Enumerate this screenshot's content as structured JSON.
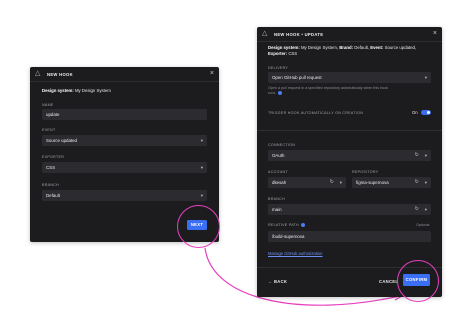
{
  "left_modal": {
    "title": "NEW HOOK",
    "summary_label": "Design system:",
    "summary_value": "My Design System",
    "name_label": "NAME",
    "name_value": "update",
    "event_label": "EVENT",
    "event_value": "Source updated",
    "exporter_label": "EXPORTER",
    "exporter_value": "CSS",
    "branch_label": "BRANCH",
    "branch_value": "Default",
    "next_label": "NEXT"
  },
  "right_modal": {
    "title": "NEW HOOK • UPDATE",
    "summary": {
      "ds_label": "Design system:",
      "ds_value": "My Design System,",
      "branch_label": "Brand:",
      "branch_value": "Default,",
      "event_label": "Event:",
      "event_value": "Source updated,",
      "exporter_label": "Exporter:",
      "exporter_value": "CSS"
    },
    "delivery_label": "DELIVERY",
    "delivery_value": "Open GitHub pull request",
    "delivery_hint": "Open a pull request in a specified repository automatically when this hook runs.",
    "trigger_label": "TRIGGER HOOK AUTOMATICALLY ON CREATION",
    "trigger_state": "On",
    "connection_label": "CONNECTION",
    "connection_value": "OAuth",
    "account_label": "ACCOUNT",
    "account_value": "dkesah",
    "repository_label": "REPOSITORY",
    "repository_value": "figma-supernova",
    "branch_label": "BRANCH",
    "branch_value": "main",
    "path_label": "RELATIVE PATH",
    "path_optional": "Optional",
    "path_value": "/build-supernova",
    "manage_link": "Manage GitHub authorization",
    "back_label": "BACK",
    "cancel_label": "CANCEL",
    "confirm_label": "CONFIRM"
  },
  "colors": {
    "accent": "#3a6ff5",
    "highlight": "#e73fbf",
    "modal_bg": "#1c1c1f",
    "field_bg": "#2b2b30"
  },
  "icons": {
    "logo": "supernova-logo-icon",
    "close": "close-icon",
    "chevron": "chevron-down-icon",
    "refresh": "refresh-icon",
    "info": "info-icon",
    "back": "arrow-left-icon"
  }
}
